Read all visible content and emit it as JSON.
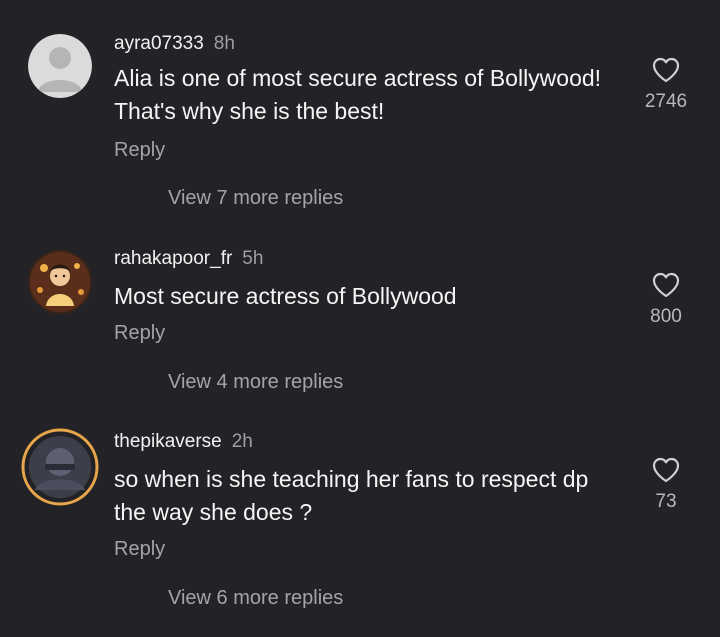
{
  "comments": [
    {
      "username": "ayra07333",
      "time": "8h",
      "text": "Alia is one of most secure actress of Bollywood! That's why she is the best!",
      "reply_label": "Reply",
      "view_replies": "View 7 more replies",
      "likes": "2746",
      "avatar": "default-user-avatar"
    },
    {
      "username": "rahakapoor_fr",
      "time": "5h",
      "text": "Most secure actress of Bollywood",
      "reply_label": "Reply",
      "view_replies": "View 4 more replies",
      "likes": "800",
      "avatar": "illustrated-profile-avatar"
    },
    {
      "username": "thepikaverse",
      "time": "2h",
      "text": "so when is she teaching her fans to respect dp the way she does ?",
      "reply_label": "Reply",
      "view_replies": "View 6 more replies",
      "likes": "73",
      "avatar": "story-ring-avatar"
    }
  ],
  "colors": {
    "background": "#232327",
    "text": "#f5f5f5",
    "secondary": "#a3a3a8",
    "story_ring": "#e8a64a"
  },
  "icons": {
    "like": "heart-outline-icon"
  }
}
